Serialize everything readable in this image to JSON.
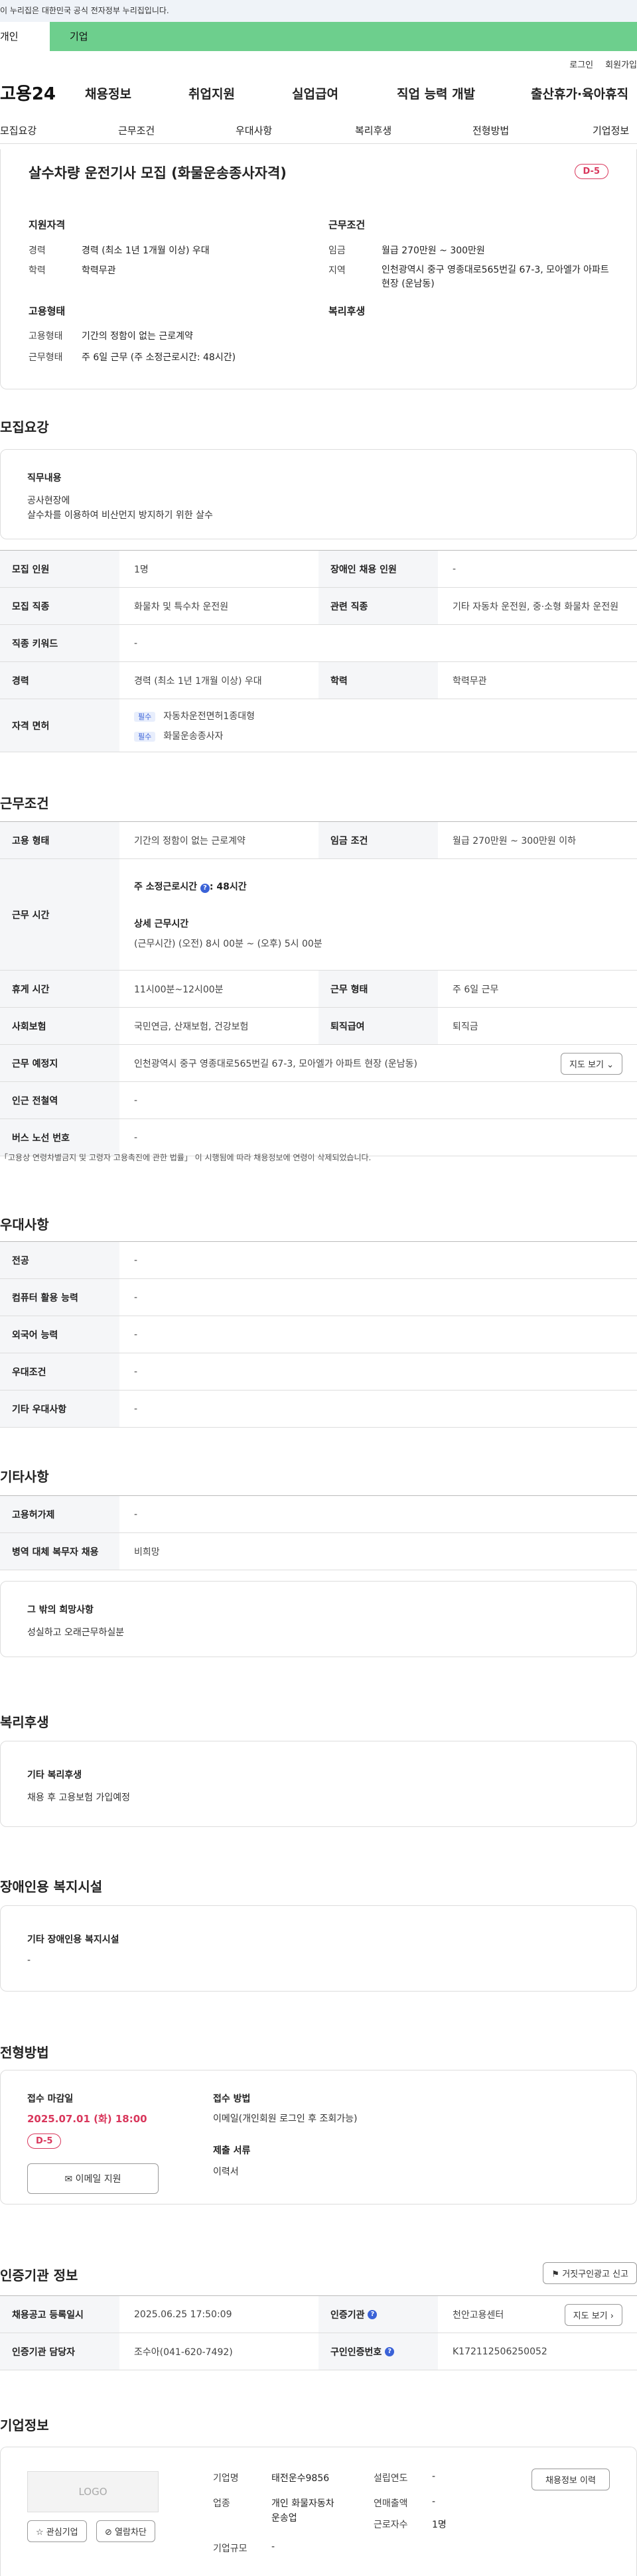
{
  "gov_banner": "이 누리집은 대한민국 공식 전자정부 누리집입니다.",
  "user_tabs": [
    "개인",
    "기업"
  ],
  "top_links": [
    "로그인",
    "회원가입"
  ],
  "logo": "고용24",
  "gnb": [
    "채용정보",
    "취업지원",
    "실업급여",
    "직업 능력 개발",
    "출산휴가·육아휴직"
  ],
  "lnb": [
    "모집요강",
    "근무조건",
    "우대사항",
    "복리후생",
    "전형방법",
    "기업정보"
  ],
  "job": {
    "title": "살수차량 운전기사 모집 (화물운송종사자격)",
    "dday": "D-5",
    "qual_h": "지원자격",
    "career_l": "경력",
    "career_v": "경력 (최소 1년 1개월 이상) 우대",
    "edu_l": "학력",
    "edu_v": "학력무관",
    "emp_h": "고용형태",
    "etype_l": "고용형태",
    "etype_v": "기간의 정함이 없는 근로계약",
    "wtype_l": "근무형태",
    "wtype_v": "주 6일 근무 (주 소정근로시간: 48시간)",
    "cond_h": "근무조건",
    "wage_l": "임금",
    "wage_v": "월급 270만원 ~ 300만원",
    "area_l": "지역",
    "area_v": "인천광역시 중구 영종대로565번길 67-3, 모아엘가 아파트 현장 (운남동)",
    "welfare_h": "복리후생"
  },
  "recruit": {
    "h": "모집요강",
    "duty_h": "직무내용",
    "duty_1": "공사현장에",
    "duty_2": "살수차를 이용하여 비산먼지 방지하기 위한 살수",
    "rows": [
      {
        "k": "모집 인원",
        "v": "1명",
        "k2": "장애인 채용 인원",
        "v2": "-"
      },
      {
        "k": "모집 직종",
        "v": "화물차 및 특수차 운전원",
        "k2": "관련 직종",
        "v2": "기타 자동차 운전원, 중·소형 화물차 운전원"
      },
      {
        "k": "직종 키워드",
        "v": "-"
      },
      {
        "k": "경력",
        "v": "경력 (최소 1년 1개월 이상) 우대",
        "k2": "학력",
        "v2": "학력무관"
      }
    ],
    "license_k": "자격 면허",
    "lic_tag": "필수",
    "lic_1": "자동차운전면허1종대형",
    "lic_2": "화물운송종사자"
  },
  "cond": {
    "h": "근무조건",
    "etype_k": "고용 형태",
    "etype_v": "기간의 정함이 없는 근로계약",
    "wage_k": "임금 조건",
    "wage_v": "월급 270만원 ~ 300만원 이하",
    "time_k": "근무 시간",
    "hours": "주 소정근로시간",
    "hours_v": ": 48시간",
    "detail_h": "상세 근무시간",
    "detail_v": "(근무시간) (오전) 8시 00분 ~ (오후) 5시 00분",
    "break_k": "휴게 시간",
    "break_v": "11시00분~12시00분",
    "wtype_k": "근무 형태",
    "wtype_v": "주 6일 근무",
    "ins_k": "사회보험",
    "ins_v": "국민연금, 산재보험, 건강보험",
    "sev_k": "퇴직급여",
    "sev_v": "퇴직금",
    "loc_k": "근무 예정지",
    "loc_v": "인천광역시 중구 영종대로565번길 67-3, 모아엘가 아파트 현장 (운남동)",
    "map_btn": "지도 보기",
    "sub_k": "인근 전철역",
    "sub_v": "-",
    "bus_k": "버스 노선 번호",
    "bus_v": "-",
    "note": "「고용상 연령차별금지 및 고령자 고용촉진에 관한 법률」 이 시행됨에 따라 채용정보에 연령이 삭제되었습니다."
  },
  "pref": {
    "h": "우대사항",
    "rows": [
      {
        "k": "전공",
        "v": "-"
      },
      {
        "k": "컴퓨터 활용 능력",
        "v": "-"
      },
      {
        "k": "외국어 능력",
        "v": "-"
      },
      {
        "k": "우대조건",
        "v": "-"
      },
      {
        "k": "기타 우대사항",
        "v": "-"
      }
    ]
  },
  "etc": {
    "h": "기타사항",
    "rows": [
      {
        "k": "고용허가제",
        "v": "-"
      },
      {
        "k": "병역 대체 복무자 채용",
        "v": "비희망"
      }
    ],
    "other_h": "그 밖의 희망사항",
    "other_v": "성실하고 오래근무하실분"
  },
  "welfare": {
    "h": "복리후생",
    "sub": "기타 복리후생",
    "v": "채용 후 고용보험 가입예정"
  },
  "disab": {
    "h": "장애인용 복지시설",
    "sub": "기타 장애인용 복지시설",
    "v": "-"
  },
  "sel": {
    "h": "전형방법",
    "deadline_h": "접수 마감일",
    "deadline_v": "2025.07.01 (화) 18:00",
    "dday": "D-5",
    "email_btn": "이메일 지원",
    "method_h": "접수 방법",
    "method_v": "이메일(개인회원 로그인 후 조회가능)",
    "docs_h": "제출 서류",
    "docs_v": "이력서"
  },
  "cert": {
    "h": "인증기관 정보",
    "report_btn": "거짓구인광고 신고",
    "reg_k": "채용공고 등록일시",
    "reg_v": "2025.06.25 17:50:09",
    "org_k": "인증기관",
    "org_v": "천안고용센터",
    "map_btn": "지도 보기",
    "mgr_k": "인증기관 담당자",
    "mgr_v": "조수아(041-620-7492)",
    "num_k": "구인인증번호",
    "num_v": "K172112506250052"
  },
  "company": {
    "h": "기업정보",
    "logo": "LOGO",
    "fav_btn": "관심기업",
    "block_btn": "열람차단",
    "name_k": "기업명",
    "name_v": "태전운수9856",
    "ind_k": "업종",
    "ind_v": "개인 화물자동차 운송업",
    "size_k": "기업규모",
    "size_v": "-",
    "year_k": "설립연도",
    "year_v": "-",
    "sales_k": "연매출액",
    "sales_v": "-",
    "emp_k": "근로자수",
    "emp_v": "1명",
    "hist_btn": "채용정보 이력"
  }
}
